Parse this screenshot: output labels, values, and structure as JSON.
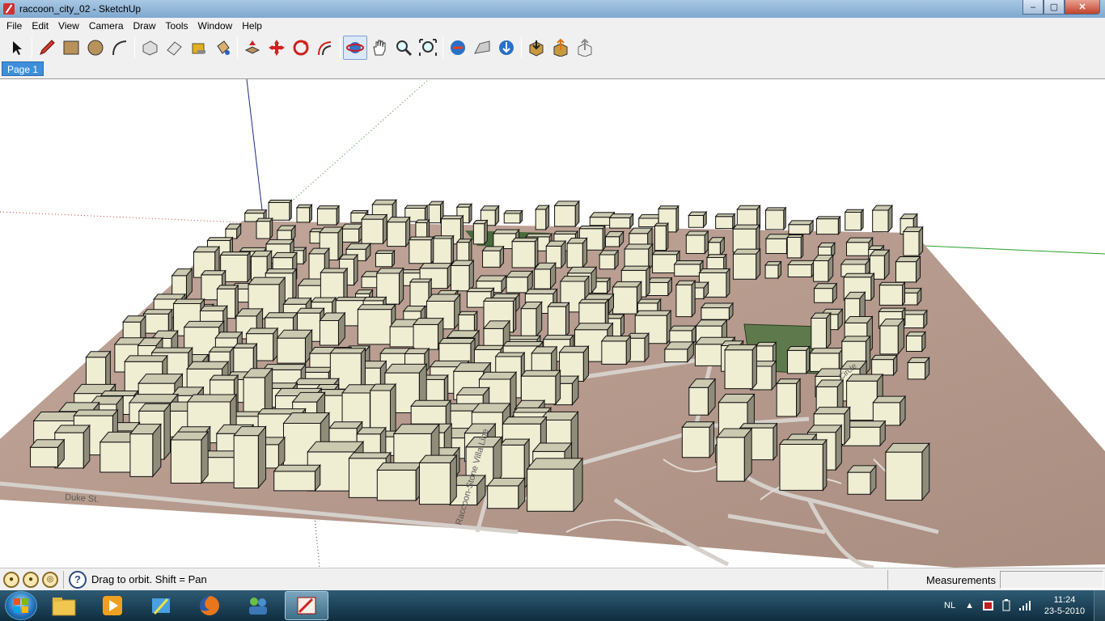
{
  "window": {
    "title": "raccoon_city_02 - SketchUp",
    "controls": {
      "minimize": "–",
      "maximize": "▢",
      "close": "✕"
    }
  },
  "menu": {
    "items": [
      "File",
      "Edit",
      "View",
      "Camera",
      "Draw",
      "Tools",
      "Window",
      "Help"
    ]
  },
  "toolbar": {
    "tools": [
      "select-icon",
      "pencil-icon",
      "rectangle-icon",
      "circle-icon",
      "arc-icon",
      "make-component-icon",
      "eraser-icon",
      "tape-measure-icon",
      "paint-bucket-icon",
      "push-pull-icon",
      "move-icon",
      "rotate-icon",
      "offset-icon",
      "orbit-icon",
      "pan-icon",
      "zoom-icon",
      "zoom-extents-icon",
      "get-current-view-icon",
      "toggle-terrain-icon",
      "place-model-icon",
      "get-models-icon",
      "share-model-icon",
      "share-component-icon"
    ]
  },
  "tabs": {
    "page1": "Page 1"
  },
  "model": {
    "street_labels": [
      "Duke St.",
      "Raccoon-Stone Villa Line",
      "Circle"
    ],
    "colors": {
      "building": "#efedd2",
      "roof": "#cbc9b0",
      "ground": "#b29586",
      "road": "#cfc9c4",
      "park": "#5e7a4c"
    }
  },
  "statusbar": {
    "hint": "Drag to orbit.  Shift = Pan",
    "measurements_label": "Measurements",
    "measurements_value": ""
  },
  "taskbar": {
    "language": "NL",
    "time": "11:24",
    "date": "23-5-2010"
  }
}
